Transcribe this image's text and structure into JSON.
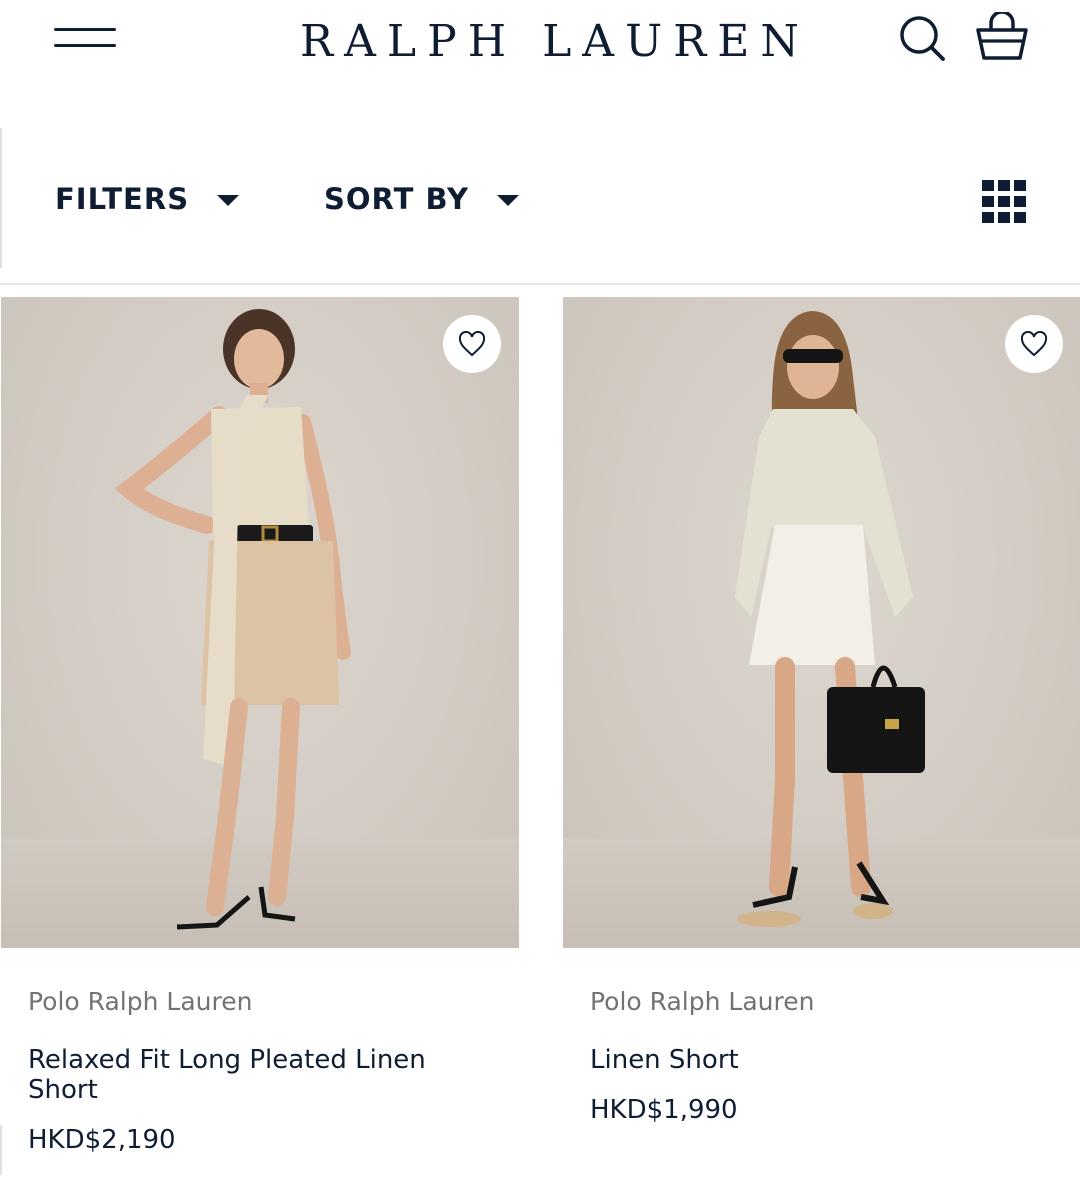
{
  "header": {
    "brand": "RALPH LAUREN",
    "menu_icon": "hamburger-menu-icon",
    "search_icon": "search-icon",
    "bag_icon": "shopping-bag-icon"
  },
  "toolbar": {
    "filters_label": "FILTERS",
    "sort_label": "SORT BY",
    "grid_icon": "grid-view-icon"
  },
  "colors": {
    "navy": "#0f1d33",
    "muted_text": "#737373",
    "photo_backdrop": "#d6cfc7"
  },
  "products": [
    {
      "brand": "Polo Ralph Lauren",
      "name": "Relaxed Fit Long Pleated Linen Short",
      "price": "HKD$2,190",
      "favorite_icon": "heart-icon"
    },
    {
      "brand": "Polo Ralph Lauren",
      "name": "Linen Short",
      "price": "HKD$1,990",
      "favorite_icon": "heart-icon"
    }
  ]
}
